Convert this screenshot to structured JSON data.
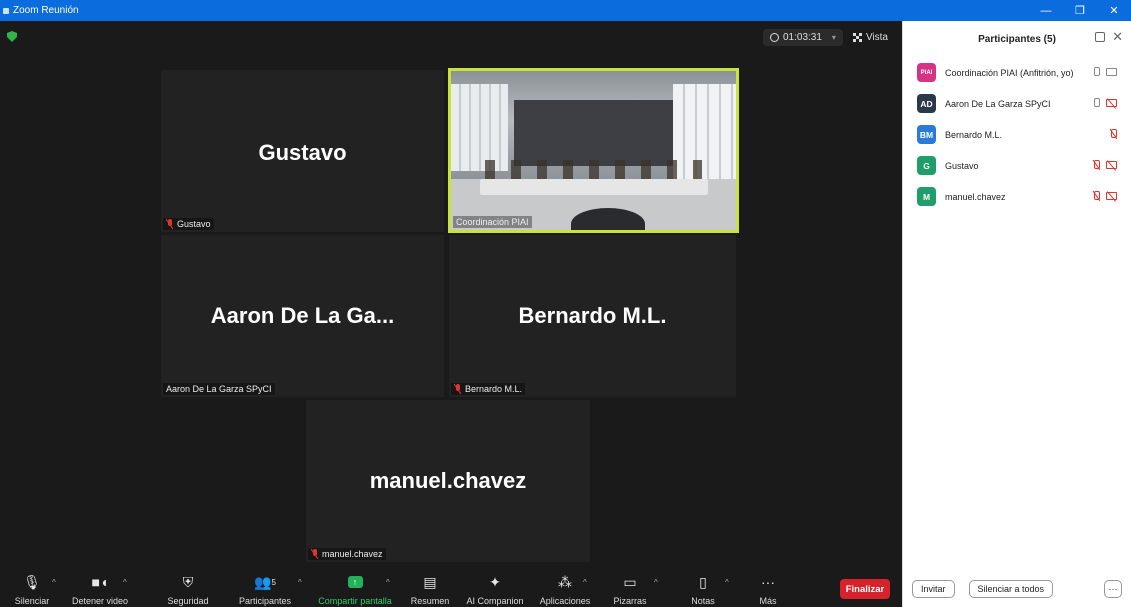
{
  "window": {
    "title": "Zoom Reunión"
  },
  "top_controls": {
    "timer": "01:03:31",
    "view_label": "Vista"
  },
  "tiles": [
    {
      "id": "gustavo",
      "big_name": "Gustavo",
      "caption": "Gustavo",
      "muted": true,
      "video": false
    },
    {
      "id": "coordinacion",
      "big_name": "",
      "caption": "Coordinación PIAI",
      "muted": false,
      "video": true
    },
    {
      "id": "aaron",
      "big_name": "Aaron De La Ga...",
      "caption": "Aaron De La Garza SPyCI",
      "muted": false,
      "video": false
    },
    {
      "id": "bernardo",
      "big_name": "Bernardo M.L.",
      "caption": "Bernardo M.L.",
      "muted": true,
      "video": false
    },
    {
      "id": "manuel",
      "big_name": "manuel.chavez",
      "caption": "manuel.chavez",
      "muted": true,
      "video": false
    }
  ],
  "toolbar": {
    "mute": "Silenciar",
    "stop_video": "Detener video",
    "security": "Seguridad",
    "participants": "Participantes",
    "participants_count": "5",
    "share": "Compartir pantalla",
    "summary": "Resumen",
    "companion": "AI Companion",
    "apps": "Aplicaciones",
    "whiteboards": "Pizarras",
    "notes": "Notas",
    "more": "Más",
    "end": "Finalizar"
  },
  "panel": {
    "title": "Participantes (5)",
    "participants": [
      {
        "initials": "PIAI",
        "name": "Coordinación PIAI (Anfitrión, yo)",
        "color": "#d63384",
        "mic_muted": false,
        "cam_off": false
      },
      {
        "initials": "AD",
        "name": "Aaron De La Garza SPyCI",
        "color": "#2b3a4a",
        "mic_muted": false,
        "cam_off": true
      },
      {
        "initials": "BM",
        "name": "Bernardo M.L.",
        "color": "#2a7bd6",
        "mic_muted": true,
        "cam_off": null
      },
      {
        "initials": "G",
        "name": "Gustavo",
        "color": "#1f9e6a",
        "mic_muted": true,
        "cam_off": true
      },
      {
        "initials": "M",
        "name": "manuel.chavez",
        "color": "#1f9e6a",
        "mic_muted": true,
        "cam_off": true
      }
    ],
    "invite": "Invitar",
    "mute_all": "Silenciar a todos",
    "more": "···"
  }
}
